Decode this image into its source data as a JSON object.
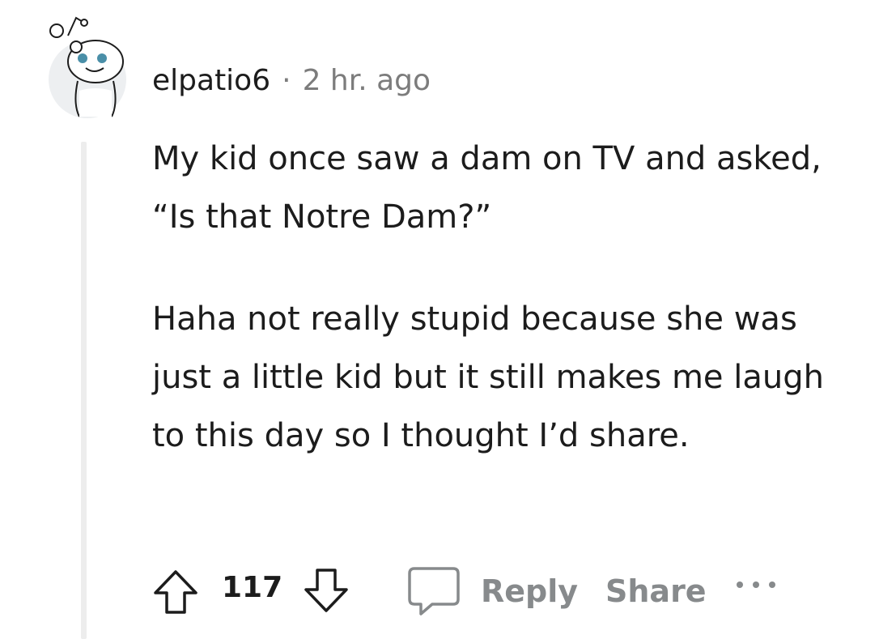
{
  "comment": {
    "username": "elpatio6",
    "separator": "·",
    "timestamp": "2 hr. ago",
    "paragraphs": [
      "My kid once saw a dam on TV and asked, “Is that Notre Dam?”",
      "Haha not really stupid because she was just a little kid but it still makes me laugh to this day so I thought I’d share."
    ]
  },
  "actions": {
    "score": "117",
    "reply_label": "Reply",
    "share_label": "Share"
  },
  "icons": {
    "avatar": "snoo-avatar-icon",
    "upvote": "arrow-up-icon",
    "downvote": "arrow-down-icon",
    "reply": "speech-bubble-icon",
    "more": "ellipsis-icon"
  },
  "colors": {
    "text": "#1c1c1c",
    "muted": "#7c7c7c",
    "action_label": "#878a8c",
    "thread_line": "#ededed",
    "avatar_bg": "#edeff1",
    "avatar_eye": "#4a8fa8"
  }
}
